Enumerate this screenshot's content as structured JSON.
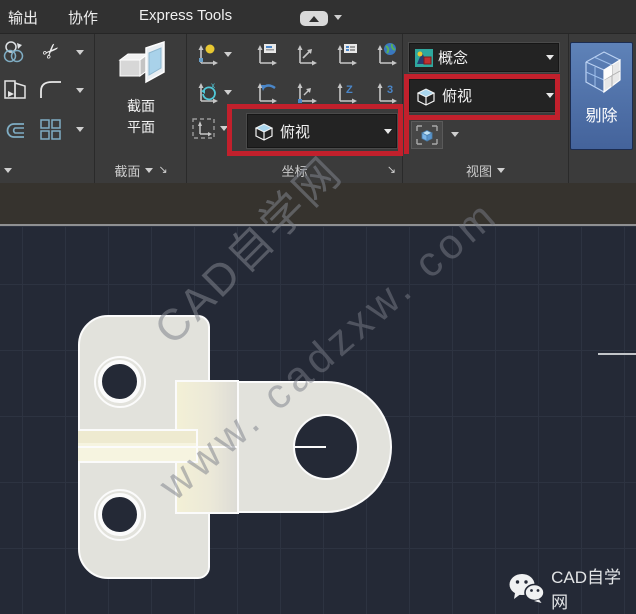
{
  "menubar": {
    "tabs": [
      "输出",
      "协作",
      "Express Tools"
    ]
  },
  "ribbon": {
    "section_panel": {
      "button_line1": "截面",
      "button_line2": "平面",
      "label": "截面"
    },
    "coords_panel": {
      "label": "坐标",
      "view_combo_value": "俯视"
    },
    "view_panel": {
      "label": "视图",
      "visual_style_value": "概念",
      "view_combo_value": "俯视"
    },
    "cull_button_label": "剔除"
  },
  "canvas": {
    "watermark_line1": "CAD自学网",
    "watermark_line2": "www. cadzxw. com",
    "logo_text": "CAD自学网"
  },
  "icons": [
    "cloud-icon",
    "copy-circles-icon",
    "trim-scissors-icon",
    "extrude-face-icon",
    "fillet-icon",
    "offset-edge-icon",
    "array-squares-icon",
    "section-plane-icon",
    "ucs-property-icon",
    "ucs-named-icon",
    "ucs-move-icon",
    "ucs-list-icon",
    "ucs-world-icon",
    "ucs-rotate-x-icon",
    "ucs-previous-icon",
    "ucs-origin-icon",
    "ucs-z-axis-icon",
    "ucs-3point-icon",
    "ucs-display-icon",
    "view-cube-icon",
    "visual-style-icon",
    "navigation-cube-icon",
    "cull-cube-icon",
    "wechat-icon",
    "dropdown-arrow-icon",
    "panel-launcher-icon"
  ],
  "colors": {
    "annotation_red": "#c2202c",
    "cull_button_blue": "#4e6fa6",
    "canvas_bg": "#242936",
    "part_fill": "#e2e2dc",
    "part_cream": "#f3f0d8"
  }
}
